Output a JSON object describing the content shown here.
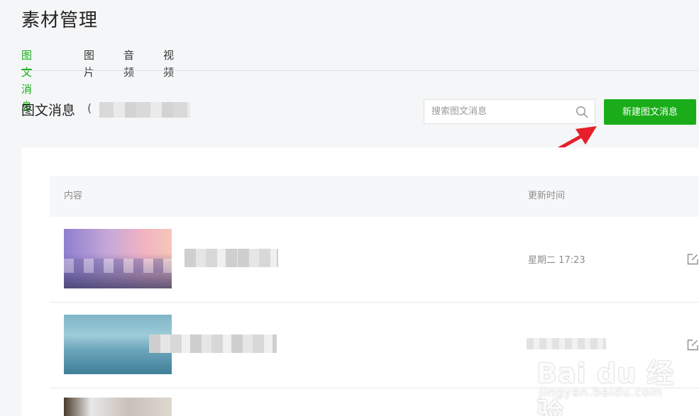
{
  "header": {
    "title": "素材管理"
  },
  "tabs": [
    {
      "label": "图文消息",
      "active": true
    },
    {
      "label": "图片",
      "active": false
    },
    {
      "label": "音频",
      "active": false
    },
    {
      "label": "视频",
      "active": false
    }
  ],
  "section": {
    "title": "图文消息",
    "count_prefix": "("
  },
  "search": {
    "placeholder": "搜索图文消息",
    "value": ""
  },
  "actions": {
    "new_label": "新建图文消息"
  },
  "table": {
    "columns": {
      "content": "内容",
      "updated": "更新时间"
    },
    "rows": [
      {
        "time": "星期二 17:23"
      },
      {
        "time": ""
      },
      {
        "time": ""
      }
    ]
  },
  "watermark": {
    "logo": "Bai du 经验",
    "sub": "jingyan.baidu.com"
  },
  "colors": {
    "accent": "#1aad19",
    "annotation": "#e5202a"
  },
  "icons": {
    "search": "search-icon",
    "edit": "edit-icon",
    "arrow": "arrow-annotation-icon"
  }
}
